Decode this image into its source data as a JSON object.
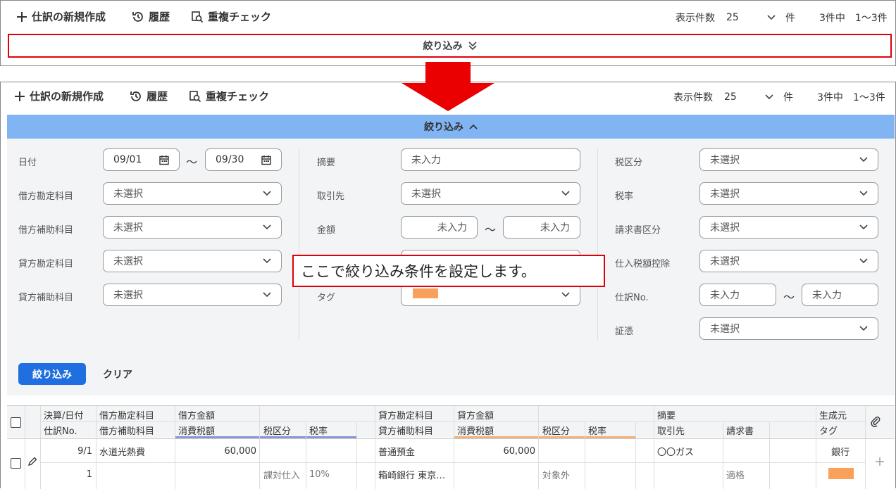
{
  "toolbar": {
    "new_label": "仕訳の新規作成",
    "history_label": "履歴",
    "duplicate_label": "重複チェック",
    "per_page_label": "表示件数",
    "per_page_value": "25",
    "per_page_unit": "件",
    "count_text": "3件中",
    "range_text": "1〜3件"
  },
  "collapsed_filter": {
    "label": "絞り込み"
  },
  "expanded_filter": {
    "label": "絞り込み",
    "col1": {
      "date_label": "日付",
      "date_from": "09/01",
      "tilde": "〜",
      "date_to": "09/30",
      "debit_account_label": "借方勘定科目",
      "debit_sub_label": "借方補助科目",
      "credit_account_label": "貸方勘定科目",
      "credit_sub_label": "貸方補助科目",
      "unselected": "未選択"
    },
    "col2": {
      "summary_label": "摘要",
      "partner_label": "取引先",
      "amount_label": "金額",
      "tag_label": "タグ",
      "empty": "未入力",
      "unselected": "未選択",
      "tilde": "〜"
    },
    "col3": {
      "tax_class_label": "税区分",
      "tax_rate_label": "税率",
      "invoice_class_label": "請求書区分",
      "deduction_label": "仕入税額控除",
      "entry_no_label": "仕訳No.",
      "voucher_label": "証憑",
      "unselected": "未選択",
      "empty": "未入力",
      "tilde": "〜"
    },
    "apply_label": "絞り込み",
    "clear_label": "クリア"
  },
  "callout": {
    "text": "ここで絞り込み条件を設定します。"
  },
  "table": {
    "headers_top": {
      "date": "決算/日付",
      "debit_account": "借方勘定科目",
      "debit_amount": "借方金額",
      "credit_account": "貸方勘定科目",
      "credit_amount": "貸方金額",
      "summary": "摘要",
      "source": "生成元"
    },
    "headers_bottom": {
      "entry_no": "仕訳No.",
      "debit_sub": "借方補助科目",
      "debit_tax": "消費税額",
      "debit_tax_class": "税区分",
      "debit_tax_rate": "税率",
      "credit_sub": "貸方補助科目",
      "credit_tax": "消費税額",
      "credit_tax_class": "税区分",
      "credit_tax_rate": "税率",
      "partner": "取引先",
      "invoice": "請求書",
      "tag": "タグ"
    },
    "row": {
      "date": "9/1",
      "entry_no": "1",
      "debit_account": "水道光熱費",
      "debit_amount": "60,000",
      "debit_tax_class": "課対仕入",
      "debit_tax_rate": "10%",
      "credit_account": "普通預金",
      "credit_sub": "箱崎銀行 東京…",
      "credit_amount": "60,000",
      "credit_tax_class": "対象外",
      "summary": "〇〇ガス",
      "invoice": "適格",
      "source": "銀行"
    }
  },
  "colors": {
    "accent": "#1f6fe0",
    "filter_bar": "#80b4f2",
    "highlight": "#e0000a",
    "tag": "#f9a05a"
  }
}
